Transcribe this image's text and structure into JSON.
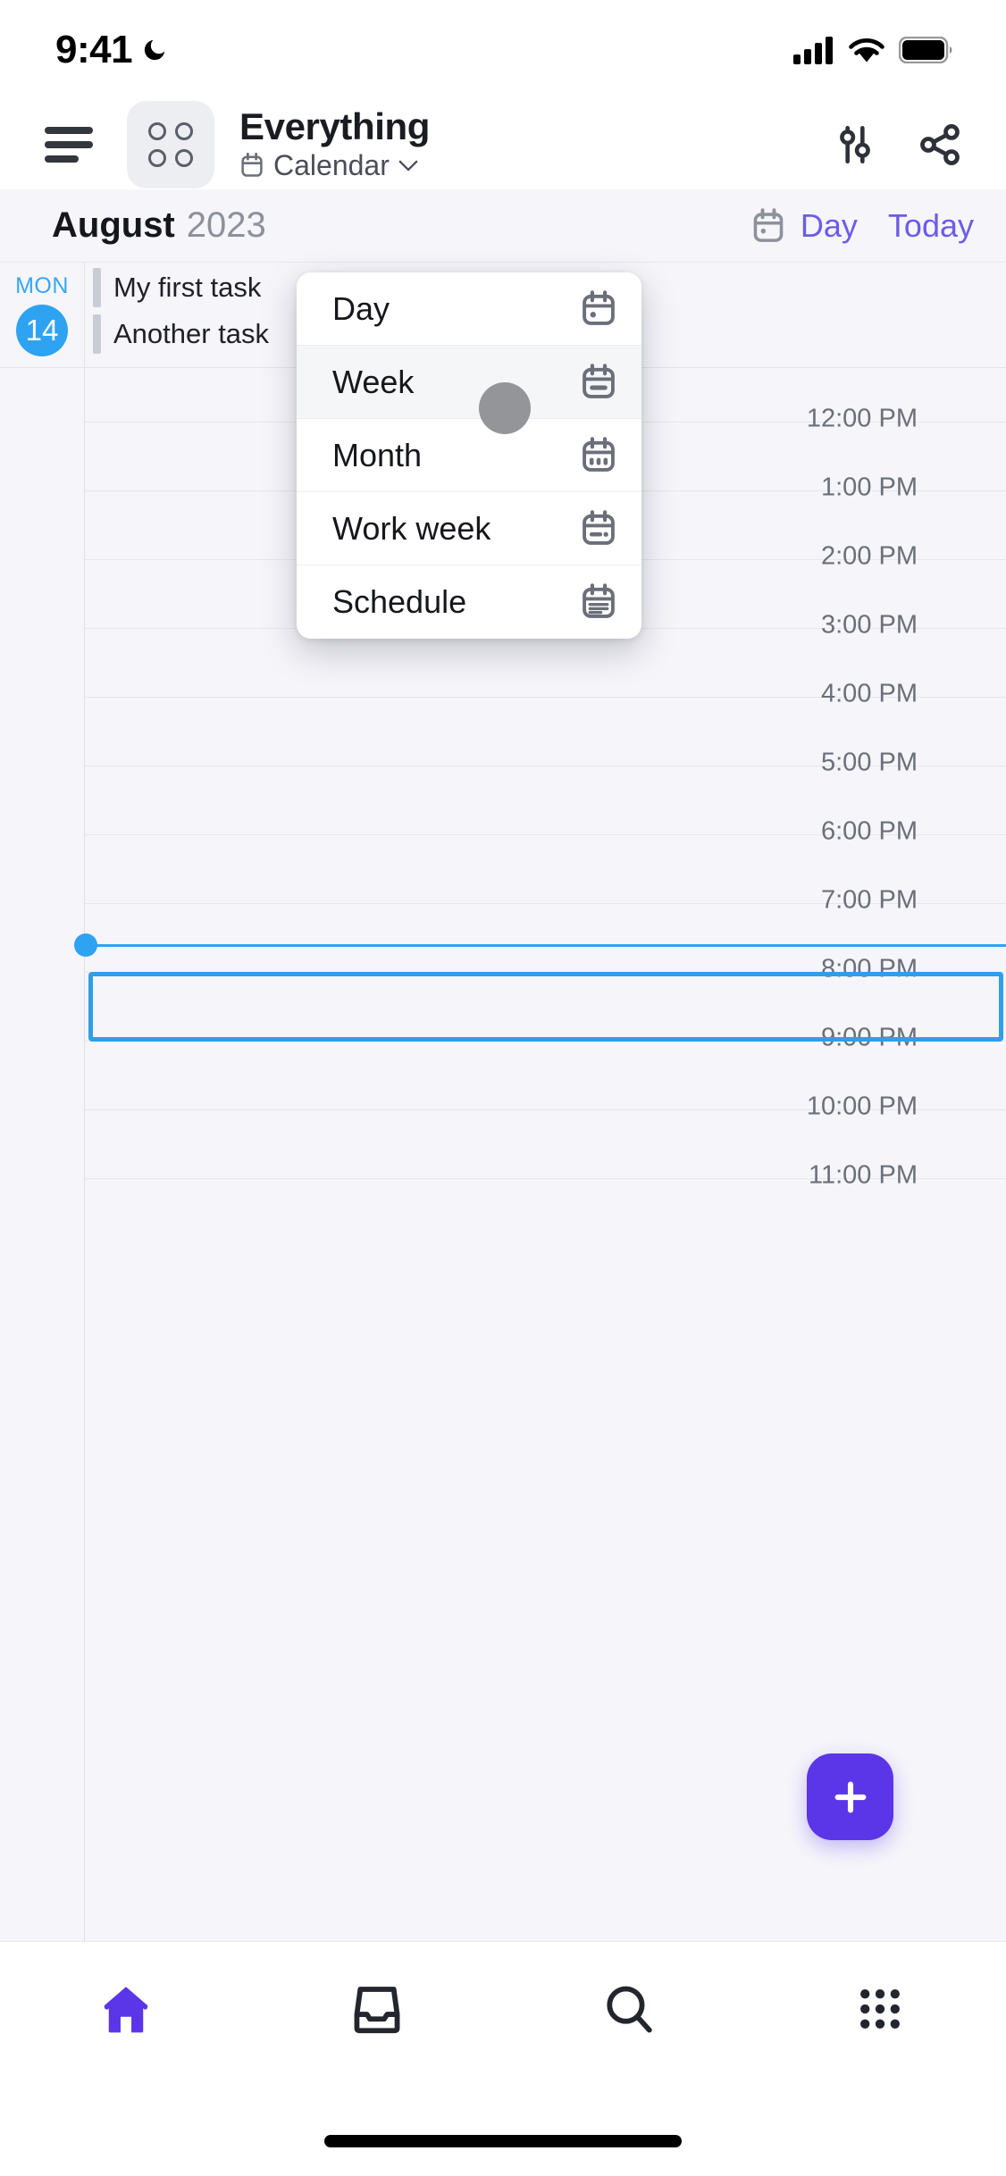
{
  "status_bar": {
    "time": "9:41",
    "moon_icon": "crescent-moon-icon",
    "signal_icon": "cellular-signal-icon",
    "wifi_icon": "wifi-icon",
    "battery_icon": "battery-full-icon"
  },
  "header": {
    "menu_icon": "hamburger-menu-icon",
    "app_icon": "four-dots-grid-icon",
    "title": "Everything",
    "subtitle": "Calendar",
    "subtitle_icon": "calendar-icon",
    "caret_icon": "chevron-down-icon",
    "settings_icon": "sliders-settings-icon",
    "share_icon": "share-icon"
  },
  "date_bar": {
    "month": "August",
    "year": "2023",
    "view_icon": "calendar-day-icon",
    "view_label": "Day",
    "today_label": "Today",
    "accent_color": "#6c5ce7"
  },
  "calendar": {
    "day_of_week": "MON",
    "day_number": "14",
    "day_accent_color": "#2ea3f2",
    "all_day_tasks": [
      {
        "title": "My first task"
      },
      {
        "title": "Another task"
      }
    ],
    "time_labels": [
      "12:00 PM",
      "1:00 PM",
      "2:00 PM",
      "3:00 PM",
      "4:00 PM",
      "5:00 PM",
      "6:00 PM",
      "7:00 PM",
      "8:00 PM",
      "9:00 PM",
      "10:00 PM",
      "11:00 PM"
    ],
    "current_time_indicator": {
      "color": "#2ea3f2",
      "position_label": "between 7:00 PM and 8:00 PM"
    },
    "selection": {
      "start_label": "8:00 PM",
      "end_label": "9:00 PM",
      "border_color": "#2f9fe8"
    }
  },
  "view_menu": {
    "items": [
      {
        "label": "Day",
        "icon": "calendar-day-icon",
        "selected": true
      },
      {
        "label": "Week",
        "icon": "calendar-week-icon",
        "selected": false
      },
      {
        "label": "Month",
        "icon": "calendar-month-icon",
        "selected": false
      },
      {
        "label": "Work week",
        "icon": "calendar-workweek-icon",
        "selected": false
      },
      {
        "label": "Schedule",
        "icon": "calendar-schedule-icon",
        "selected": false
      }
    ],
    "touch_indicator": "touch-point-indicator"
  },
  "fab": {
    "icon": "plus-icon",
    "color": "#5b35e8"
  },
  "bottom_nav": {
    "items": [
      {
        "icon": "home-icon",
        "active": true
      },
      {
        "icon": "inbox-icon",
        "active": false
      },
      {
        "icon": "search-icon",
        "active": false
      },
      {
        "icon": "apps-grid-icon",
        "active": false
      }
    ],
    "active_color": "#5b35e8",
    "home_indicator": "home-indicator-bar"
  }
}
